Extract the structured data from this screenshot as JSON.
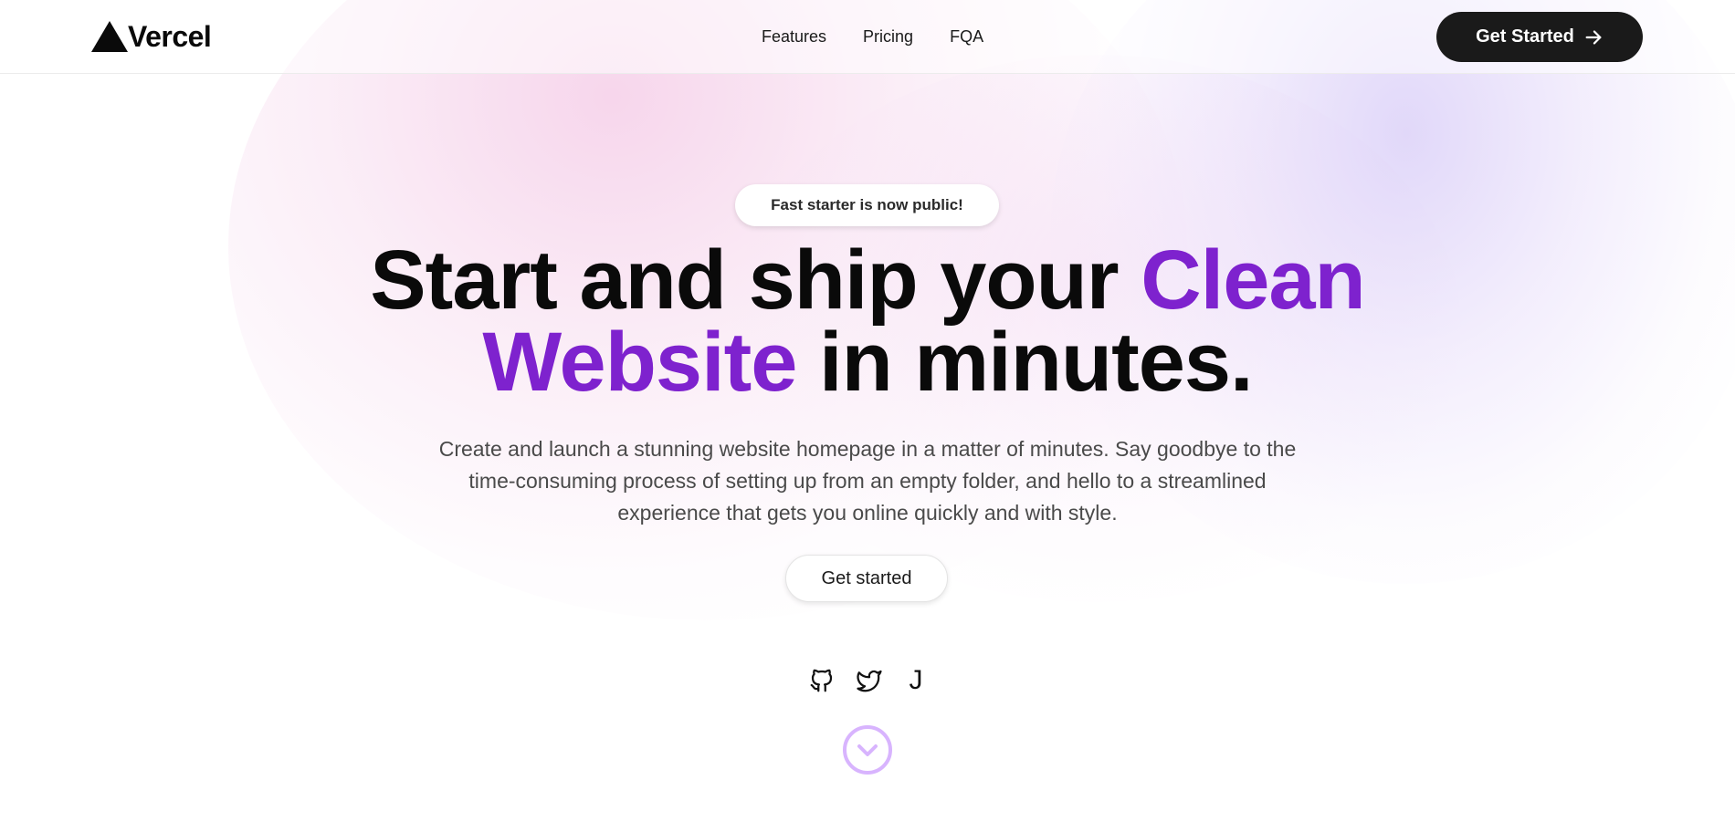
{
  "brand": {
    "name": "Vercel",
    "logo_icon": "triangle-icon"
  },
  "nav": {
    "items": [
      {
        "label": "Features"
      },
      {
        "label": "Pricing"
      },
      {
        "label": "FQA"
      }
    ],
    "cta_label": "Get Started",
    "cta_icon": "arrow-right-icon"
  },
  "hero": {
    "badge": "Fast starter is now public!",
    "headline": {
      "part1": "Start and ship your ",
      "accent1": "Clean",
      "accent2": "Website",
      "part2": " in minutes."
    },
    "subtitle": "Create and launch a stunning website homepage in a matter of minutes. Say goodbye to the time-consuming process of setting up from an empty folder, and hello to a streamlined experience that gets you online quickly and with style.",
    "cta_label": "Get started",
    "socials": [
      {
        "icon": "github-icon"
      },
      {
        "icon": "twitter-icon"
      },
      {
        "icon": "j-icon",
        "text": "J"
      }
    ],
    "scroll_icon": "chevron-down-circle-icon"
  },
  "colors": {
    "accent": "#7e22ce",
    "header_button": "#1a1a1a",
    "scroll_ring": "#d8b4fe",
    "text": "#0a0a0a",
    "muted": "#4a4a4a"
  }
}
